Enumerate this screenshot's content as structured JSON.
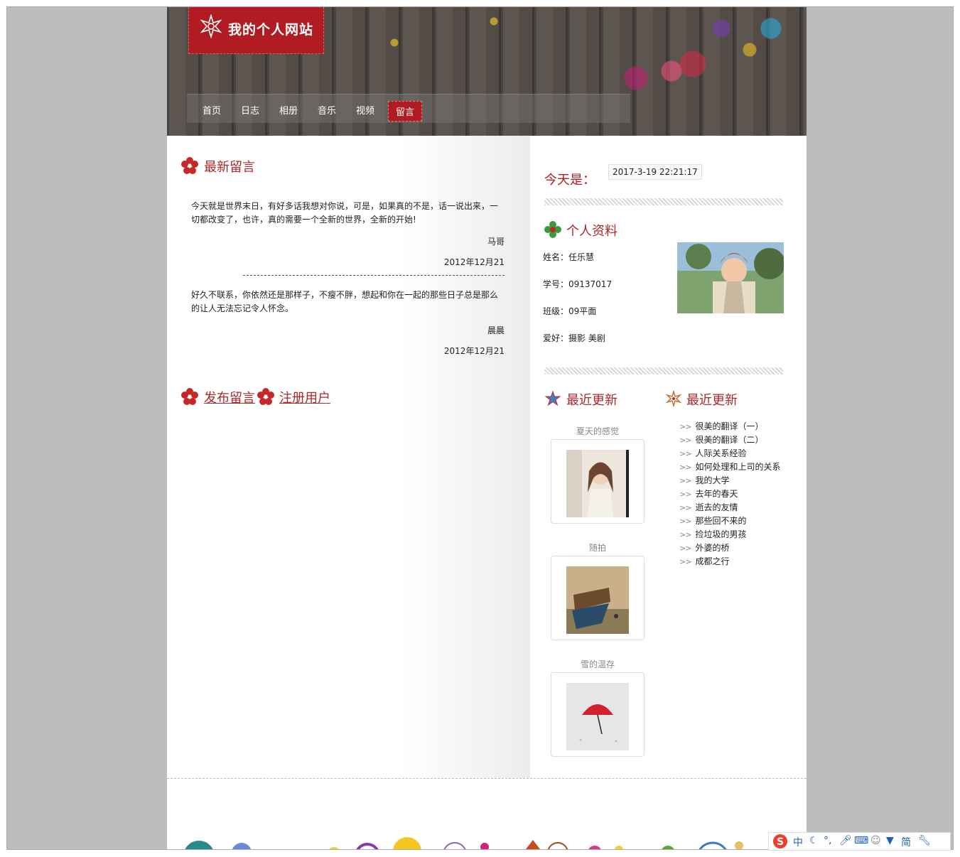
{
  "site": {
    "title": "我的个人网站"
  },
  "nav": [
    "首页",
    "日志",
    "相册",
    "音乐",
    "视频",
    "留言"
  ],
  "nav_active": "留言",
  "messages_section": {
    "title": "最新留言",
    "messages": [
      {
        "text": "今天就是世界末日，有好多话我想对你说，可是，如果真的不是，话一说出来，一切都改变了，也许，真的需要一个全新的世界，全新的开始!",
        "author": "马哥",
        "date": "2012年12月21"
      },
      {
        "text": "好久不联系，你依然还是那样子，不瘦不胖，想起和你在一起的那些日子总是那么的让人无法忘记令人怀念。",
        "author": "晨晨",
        "date": "2012年12月21"
      }
    ]
  },
  "actions": {
    "post": "发布留言",
    "register": "注册用户"
  },
  "today": {
    "label": "今天是：",
    "value": "2017-3-19 22:21:17"
  },
  "profile": {
    "title": "个人资料",
    "name": "姓名：任乐慧",
    "id": "学号：09137017",
    "class": "班级：09平面",
    "hobby": "爱好：摄影 美剧"
  },
  "recent_photos": {
    "title": "最近更新",
    "items": [
      "夏天的感觉",
      "随拍",
      "雪的温存"
    ]
  },
  "recent_posts": {
    "title": "最近更新",
    "items": [
      "很美的翻译（一）",
      "很美的翻译（二）",
      "人际关系经验",
      "如何处理和上司的关系",
      "我的大学",
      "去年的春天",
      "逝去的友情",
      "那些回不来的",
      "捡垃圾的男孩",
      "外婆的桥",
      "成都之行"
    ]
  },
  "ime": {
    "items": [
      "中",
      "简"
    ]
  },
  "colors": {
    "accent": "#b01c22",
    "title": "#a82a2a",
    "frame": "#bdbdbd"
  }
}
